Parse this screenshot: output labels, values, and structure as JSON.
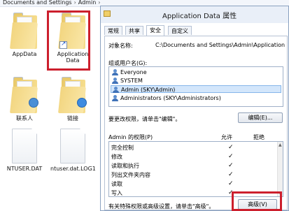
{
  "explorer": {
    "breadcrumb": [
      "Documents and Settings",
      "Admin"
    ],
    "files": [
      {
        "name": "AppData",
        "type": "folder"
      },
      {
        "name": "Application Data",
        "type": "folder-shortcut"
      },
      {
        "name": "联系人",
        "type": "contacts"
      },
      {
        "name": "链接",
        "type": "links"
      },
      {
        "name": "NTUSER.DAT",
        "type": "file"
      },
      {
        "name": "ntuser.dat.LOG1",
        "type": "file"
      }
    ]
  },
  "dialog": {
    "title": "Application Data 属性",
    "tabs": [
      "常规",
      "共享",
      "安全",
      "自定义"
    ],
    "active_tab": "安全",
    "object_name_label": "对象名称:",
    "object_name_value": "C:\\Documents and Settings\\Admin\\Application D",
    "groups_label": "组或用户名(G):",
    "groups": [
      {
        "name": "Everyone",
        "selected": false
      },
      {
        "name": "SYSTEM",
        "selected": false
      },
      {
        "name": "Admin (SKY\\Admin)",
        "selected": true
      },
      {
        "name": "Administrators (SKY\\Administrators)",
        "selected": false
      }
    ],
    "edit_hint": "要更改权限，请单击\"编辑\"。",
    "edit_button": "编辑(E)...",
    "permissions_label": "Admin 的权限(P)",
    "allow_label": "允许",
    "deny_label": "拒绝",
    "permissions": [
      {
        "name": "完全控制",
        "allow": "✓"
      },
      {
        "name": "修改",
        "allow": "✓"
      },
      {
        "name": "读取和执行",
        "allow": "✓"
      },
      {
        "name": "列出文件夹内容",
        "allow": "✓"
      },
      {
        "name": "读取",
        "allow": "✓"
      },
      {
        "name": "写入",
        "allow": "✓"
      }
    ],
    "advanced_hint": "有关特殊权限或高级设置，请单击\"高级\"。",
    "advanced_button": "高级(V)"
  },
  "colors": {
    "highlight": "#cc1f2d",
    "selection": "#d3e6fb"
  }
}
